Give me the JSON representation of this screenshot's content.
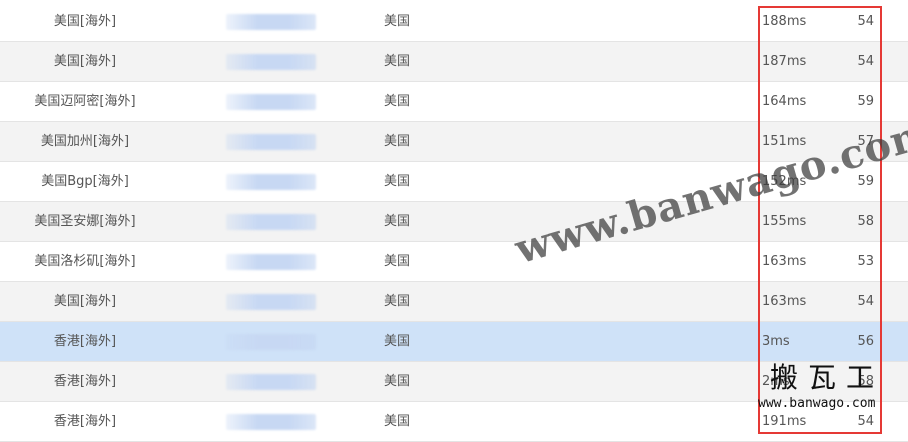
{
  "rows": [
    {
      "node": "美国[海外]",
      "location": "美国",
      "time": "188ms",
      "ttl": "54"
    },
    {
      "node": "美国[海外]",
      "location": "美国",
      "time": "187ms",
      "ttl": "54"
    },
    {
      "node": "美国迈阿密[海外]",
      "location": "美国",
      "time": "164ms",
      "ttl": "59"
    },
    {
      "node": "美国加州[海外]",
      "location": "美国",
      "time": "151ms",
      "ttl": "57"
    },
    {
      "node": "美国Bgp[海外]",
      "location": "美国",
      "time": "152ms",
      "ttl": "59"
    },
    {
      "node": "美国圣安娜[海外]",
      "location": "美国",
      "time": "155ms",
      "ttl": "58"
    },
    {
      "node": "美国洛杉矶[海外]",
      "location": "美国",
      "time": "163ms",
      "ttl": "53"
    },
    {
      "node": "美国[海外]",
      "location": "美国",
      "time": "163ms",
      "ttl": "54"
    },
    {
      "node": "香港[海外]",
      "location": "美国",
      "time": "3ms",
      "ttl": "56"
    },
    {
      "node": "香港[海外]",
      "location": "美国",
      "time": "2ms",
      "ttl": "58"
    },
    {
      "node": "香港[海外]",
      "location": "美国",
      "time": "191ms",
      "ttl": "54"
    }
  ],
  "watermark": {
    "text": "www.banwago.com"
  },
  "logo": {
    "name": "搬瓦工",
    "url": "www.banwago.com"
  },
  "colors": {
    "highlight": "#cfe2f8",
    "alt_row": "#f3f3f3",
    "box": "#e53935"
  }
}
